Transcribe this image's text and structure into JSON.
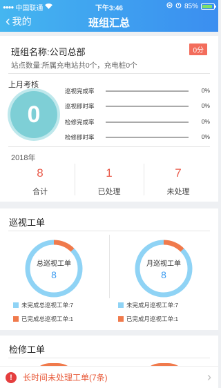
{
  "status_bar": {
    "carrier": "中国联通",
    "time": "下午3:46",
    "battery": "85%",
    "battery_level": 0.85
  },
  "nav": {
    "back_label": "我的",
    "title": "班组汇总"
  },
  "team": {
    "name": "班组名称:公司总部",
    "score": "0分",
    "station_info": "站点数量:所属充电站共0个，充电桩0个"
  },
  "last_month": {
    "label": "上月考核",
    "big_value": "0",
    "metrics": [
      {
        "label": "巡视完成率",
        "value": "0%"
      },
      {
        "label": "巡视即时率",
        "value": "0%"
      },
      {
        "label": "检修完成率",
        "value": "0%"
      },
      {
        "label": "检修即时率",
        "value": "0%"
      }
    ]
  },
  "year_stats": {
    "year": "2018年",
    "items": [
      {
        "value": "8",
        "label": "合计"
      },
      {
        "value": "1",
        "label": "已处理"
      },
      {
        "value": "7",
        "label": "未处理"
      }
    ]
  },
  "inspection": {
    "title": "巡视工单",
    "colors": {
      "incomplete": "#8fd3f5",
      "complete": "#f07a4c"
    },
    "charts": [
      {
        "center_label": "总巡视工单",
        "total": "8",
        "incomplete": 7,
        "complete": 1,
        "legend_incomplete": "未完成总巡视工单:7",
        "legend_complete": "已完成总巡视工单:1"
      },
      {
        "center_label": "月巡视工单",
        "total": "8",
        "incomplete": 7,
        "complete": 1,
        "legend_incomplete": "未完成月巡视工单:7",
        "legend_complete": "已完成月巡视工单:1"
      }
    ]
  },
  "maintenance": {
    "title": "检修工单"
  },
  "alert": {
    "text": "长时间未处理工单(7条)"
  }
}
